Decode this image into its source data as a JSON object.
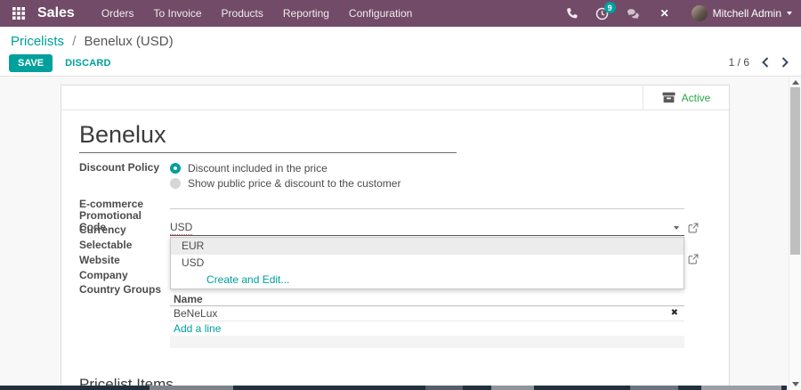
{
  "navbar": {
    "app_name": "Sales",
    "menus": [
      "Orders",
      "To Invoice",
      "Products",
      "Reporting",
      "Configuration"
    ],
    "activity_badge": "9",
    "user_name": "Mitchell Admin"
  },
  "control_panel": {
    "breadcrumb_parent": "Pricelists",
    "breadcrumb_separator": "/",
    "breadcrumb_current": "Benelux (USD)",
    "save_label": "SAVE",
    "discard_label": "DISCARD",
    "pager": "1 / 6"
  },
  "form": {
    "active_button": "Active",
    "title": "Benelux",
    "fields": {
      "discount_policy_label": "Discount Policy",
      "radio_selected": "Discount included in the price",
      "radio_unselected": "Show public price & discount to the customer",
      "promo_label_line1": "E-commerce",
      "promo_label_line2": "Promotional Code",
      "promo_value": "",
      "currency_label": "Currency",
      "currency_value": "USD",
      "selectable_label": "Selectable",
      "website_label": "Website",
      "company_label": "Company",
      "country_groups_label": "Country Groups"
    },
    "dropdown": {
      "options": [
        "EUR",
        "USD"
      ],
      "create_label": "Create and Edit..."
    },
    "country_table": {
      "header": "Name",
      "rows": [
        "BeNeLux"
      ],
      "add_line_label": "Add a line"
    },
    "pricelist_items_heading": "Pricelist Items"
  },
  "icons": {
    "close_glyph": "✕",
    "delete_glyph": "✖"
  },
  "colors": {
    "navbar_bg": "#714B67",
    "accent_teal": "#00A09D",
    "active_green": "#28a745",
    "pager_chevron": "#374b63",
    "spellcheck_red": "#e05252"
  }
}
